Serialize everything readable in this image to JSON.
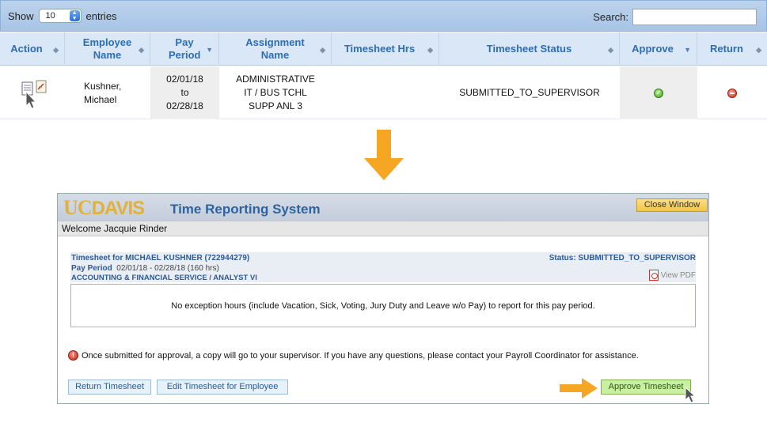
{
  "datatable": {
    "show_label": "Show",
    "entries_value": "10",
    "entries_label": "entries",
    "search_label": "Search:",
    "search_value": "",
    "columns": [
      {
        "label": "Action"
      },
      {
        "label": "Employee Name"
      },
      {
        "label": "Pay Period"
      },
      {
        "label": "Assignment Name"
      },
      {
        "label": "Timesheet Hrs"
      },
      {
        "label": "Timesheet Status"
      },
      {
        "label": "Approve"
      },
      {
        "label": "Return"
      }
    ],
    "row": {
      "employee_line1": "Kushner,",
      "employee_line2": "Michael",
      "period_start": "02/01/18",
      "period_to": "to",
      "period_end": "02/28/18",
      "assignment_line1": "ADMINISTRATIVE",
      "assignment_line2": "IT / BUS TCHL",
      "assignment_line3": "SUPP ANL 3",
      "hours": "",
      "status": "SUBMITTED_TO_SUPERVISOR"
    }
  },
  "trs": {
    "logo_uc": "UC",
    "logo_davis": "DAVIS",
    "title": "Time Reporting System",
    "close_button": "Close Window",
    "welcome": "Welcome Jacquie Rinder",
    "timesheet_for": "Timesheet for MICHAEL KUSHNER (722944279)",
    "pay_period_label": "Pay Period",
    "pay_period_value": "02/01/18 - 02/28/18 (160 hrs)",
    "department": "ACCOUNTING & FINANCIAL SERVICE / ANALYST VI",
    "status": "Status: SUBMITTED_TO_SUPERVISOR",
    "view_pdf": "View PDF",
    "exception_message": "No exception hours (include Vacation, Sick, Voting, Jury Duty and Leave w/o Pay) to report for this pay period.",
    "notice": "Once submitted for approval, a copy will go to your supervisor. If you have any questions, please contact your Payroll Coordinator for assistance.",
    "return_button": "Return Timesheet",
    "edit_button": "Edit Timesheet for Employee",
    "approve_button": "Approve Timesheet"
  },
  "colors": {
    "header_text": "#2a6eb8",
    "arrow": "#f5a623",
    "approve_green": "#3ea22a",
    "return_red": "#d2301d",
    "logo_gold": "#e1b13a"
  },
  "icons": [
    "timesheet-doc-icon",
    "edit-doc-icon",
    "cursor-icon",
    "approve-check-icon",
    "return-minus-icon",
    "down-arrow-icon",
    "pdf-icon",
    "notice-icon",
    "right-arrow-icon"
  ]
}
